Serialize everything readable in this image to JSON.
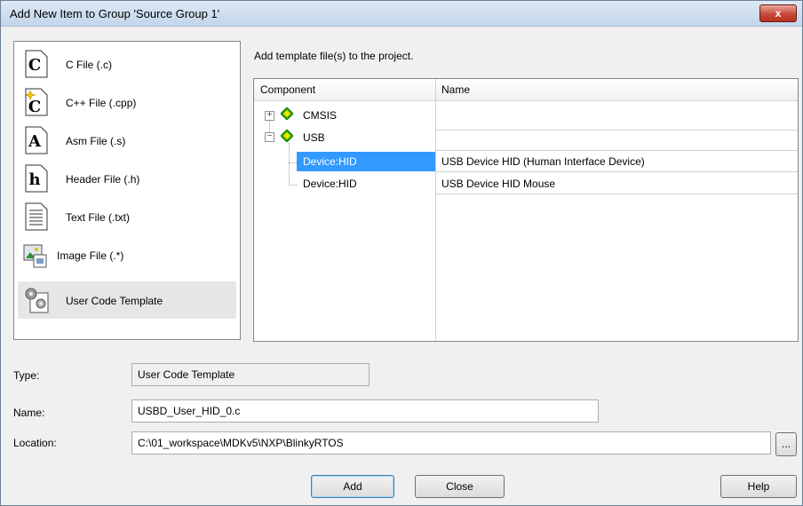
{
  "window": {
    "title": "Add New Item to Group 'Source Group 1'",
    "close_label": "x"
  },
  "file_types": [
    {
      "label": "C File (.c)",
      "icon": "c-file-icon",
      "glyph": "C"
    },
    {
      "label": "C++ File (.cpp)",
      "icon": "cpp-file-icon",
      "glyph": "C"
    },
    {
      "label": "Asm File (.s)",
      "icon": "asm-file-icon",
      "glyph": "A"
    },
    {
      "label": "Header File (.h)",
      "icon": "header-file-icon",
      "glyph": "h"
    },
    {
      "label": "Text File (.txt)",
      "icon": "text-file-icon",
      "glyph": ""
    },
    {
      "label": "Image File (.*)",
      "icon": "image-file-icon",
      "glyph": ""
    },
    {
      "label": "User Code Template",
      "icon": "gears-icon",
      "glyph": ""
    }
  ],
  "selected_file_type": "User Code Template",
  "template": {
    "hint": "Add template file(s) to the project.",
    "columns": {
      "component": "Component",
      "name": "Name"
    },
    "rows": [
      {
        "component": "CMSIS",
        "name": "",
        "level": 0,
        "expander": "+"
      },
      {
        "component": "USB",
        "name": "",
        "level": 0,
        "expander": "−"
      },
      {
        "component": "Device:HID",
        "name": "USB Device HID (Human Interface Device)",
        "level": 1,
        "selected": true
      },
      {
        "component": "Device:HID",
        "name": "USB Device HID Mouse",
        "level": 1
      }
    ]
  },
  "form": {
    "type_label": "Type:",
    "type_value": "User Code Template",
    "name_label": "Name:",
    "name_value": "USBD_User_HID_0.c",
    "location_label": "Location:",
    "location_value": "C:\\01_workspace\\MDKv5\\NXP\\BlinkyRTOS",
    "browse_label": "..."
  },
  "buttons": {
    "add": "Add",
    "close": "Close",
    "help": "Help"
  },
  "colors": {
    "selection": "#3399ff",
    "component_icon": "#2db300"
  }
}
